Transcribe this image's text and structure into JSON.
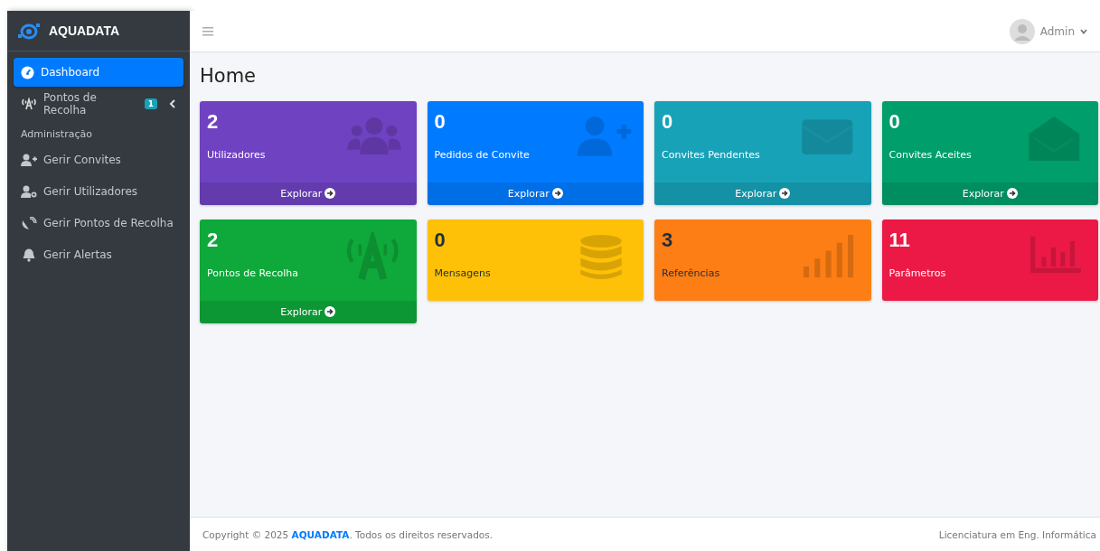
{
  "brand": {
    "name": "AQUADATA"
  },
  "sidebar": {
    "items": [
      {
        "label": "Dashboard",
        "selected": true
      },
      {
        "label": "Pontos de Recolha",
        "selected": false,
        "badge": "1",
        "expanded": false
      }
    ],
    "section": "Administração",
    "admin_items": [
      {
        "label": "Gerir Convites",
        "selected": false
      },
      {
        "label": "Gerir Utilizadores",
        "selected": false
      },
      {
        "label": "Gerir Pontos de Recolha",
        "selected": false
      },
      {
        "label": "Gerir Alertas",
        "selected": false
      }
    ]
  },
  "topbar": {
    "user": "Admin"
  },
  "page": {
    "title": "Home"
  },
  "cards": [
    {
      "value": "2",
      "label": "Utilizadores",
      "color": "#6f42c1",
      "link": "Explorar"
    },
    {
      "value": "0",
      "label": "Pedidos de Convite",
      "color": "#007bff",
      "link": "Explorar"
    },
    {
      "value": "0",
      "label": "Convites Pendentes",
      "color": "#17a2b8",
      "link": "Explorar"
    },
    {
      "value": "0",
      "label": "Convites Aceites",
      "color": "#009e6a",
      "link": "Explorar"
    },
    {
      "value": "2",
      "label": "Pontos de Recolha",
      "color": "#0fa83a",
      "link": "Explorar"
    },
    {
      "value": "0",
      "label": "Mensagens",
      "color": "#ffc107"
    },
    {
      "value": "3",
      "label": "Referências",
      "color": "#fd7e14"
    },
    {
      "value": "11",
      "label": "Parâmetros",
      "color": "#ec1946"
    }
  ],
  "footer": {
    "prefix": "Copyright © 2025 ",
    "brand": "AQUADATA",
    "suffix": ". Todos os direitos reservados.",
    "right": "Licenciatura em Eng. Informática"
  }
}
